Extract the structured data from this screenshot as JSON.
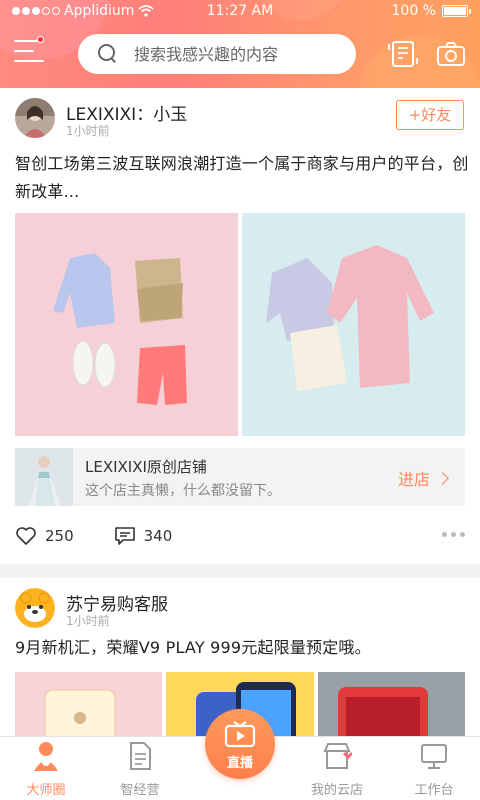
{
  "status_bar": {
    "carrier": "Applidium",
    "time": "11:27 AM",
    "battery_text": "100 %",
    "battery_level": 1.0
  },
  "header": {
    "search_placeholder": "搜索我感兴趣的内容",
    "has_notification_dot": true
  },
  "posts": [
    {
      "author": "LEXIXIXI：小玉",
      "time": "1小时前",
      "follow_label": "+好友",
      "text": "智创工场第三波互联网浪潮打造一个属于商家与用户的平台，创新改革...",
      "shop": {
        "name": "LEXIXIXI原创店铺",
        "description": "这个店主真懒，什么都没留下。",
        "enter_label": "进店"
      },
      "likes": "250",
      "comments": "340"
    },
    {
      "author": "苏宁易购客服",
      "time": "1小时前",
      "text": "9月新机汇，荣耀V9 PLAY 999元起限量预定哦。"
    }
  ],
  "tabbar": {
    "tabs": [
      {
        "label": "大师圈",
        "active": true
      },
      {
        "label": "智经营",
        "active": false
      },
      {
        "label": "直播",
        "active": false
      },
      {
        "label": "我的云店",
        "active": false
      },
      {
        "label": "工作台",
        "active": false
      }
    ]
  },
  "colors": {
    "accent": "#ff8a5c",
    "header_start": "#ff8a7d",
    "header_end": "#ffa05e",
    "notification": "#ff2a3a"
  }
}
